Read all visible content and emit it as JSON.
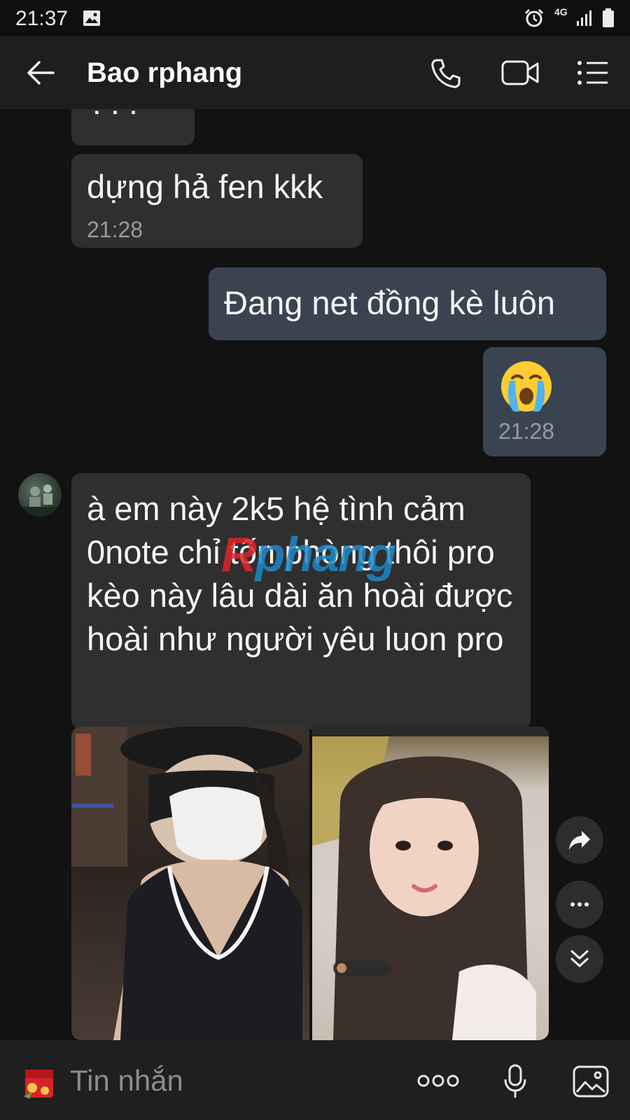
{
  "status_bar": {
    "time": "21:37",
    "network": "4G",
    "icons": [
      "image-icon",
      "alarm-icon",
      "signal-icon",
      "battery-icon"
    ]
  },
  "header": {
    "contact_name": "Bao rphang",
    "icons": [
      "back-arrow-icon",
      "phone-call-icon",
      "video-call-icon",
      "menu-list-icon"
    ]
  },
  "messages": [
    {
      "direction": "incoming",
      "text": "???",
      "time": ""
    },
    {
      "direction": "incoming",
      "text": "dựng hả fen kkk",
      "time": "21:28"
    },
    {
      "direction": "outgoing",
      "text": "Đang net đồng kè luôn",
      "time": ""
    },
    {
      "direction": "outgoing",
      "emoji": "loudly-crying-face",
      "time": "21:28"
    },
    {
      "direction": "incoming",
      "text": "à em này 2k5 hệ tình cảm 0note chỉ tốn phòng thôi pro kèo này lâu dài ăn hoài được hoài như người yêu luon pro",
      "time": ""
    },
    {
      "direction": "incoming",
      "type": "photo-album",
      "photos": 2
    }
  ],
  "watermark": {
    "red": "R",
    "blue": "phang"
  },
  "floating_actions": [
    "share-forward-icon",
    "more-options-icon",
    "scroll-down-icon"
  ],
  "compose": {
    "placeholder": "Tin nhắn",
    "icons": [
      "sticker-icon",
      "more-dots-icon",
      "microphone-icon",
      "gallery-icon"
    ]
  },
  "colors": {
    "background": "#121212",
    "incoming_bubble": "#2f2f2f",
    "outgoing_bubble": "#3a4451",
    "header": "#1e1e1e"
  }
}
